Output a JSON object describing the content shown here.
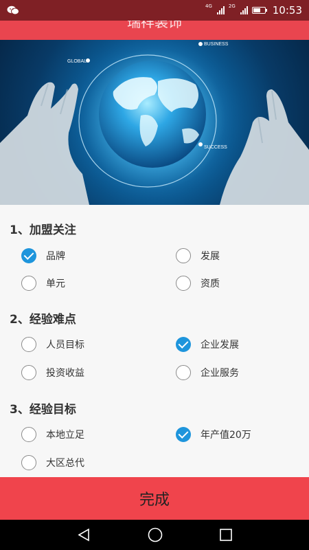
{
  "status_bar": {
    "left_icon": "wechat-icon",
    "net_label_1": "4G",
    "net_label_2": "2G",
    "time": "10:53",
    "battery_level": 0.6
  },
  "app": {
    "title": "瑞祥装饰"
  },
  "banner": {
    "global_label": "GLOBAL",
    "business_label": "BUSINESS",
    "success_label": "SUCCESS"
  },
  "form": {
    "sections": [
      {
        "title": "1、加盟关注",
        "options": [
          {
            "label": "品牌",
            "checked": true
          },
          {
            "label": "发展",
            "checked": false
          },
          {
            "label": "单元",
            "checked": false
          },
          {
            "label": "资质",
            "checked": false
          }
        ]
      },
      {
        "title": "2、经验难点",
        "options": [
          {
            "label": "人员目标",
            "checked": false
          },
          {
            "label": "企业发展",
            "checked": true
          },
          {
            "label": "投资收益",
            "checked": false
          },
          {
            "label": "企业服务",
            "checked": false
          }
        ]
      },
      {
        "title": "3、经验目标",
        "options": [
          {
            "label": "本地立足",
            "checked": false
          },
          {
            "label": "年产值20万",
            "checked": true
          },
          {
            "label": "大区总代",
            "checked": false
          }
        ]
      }
    ]
  },
  "done_button": {
    "label": "完成"
  },
  "nav_bar": {
    "back_icon": "back-triangle-icon",
    "home_icon": "home-circle-icon",
    "recent_icon": "recent-square-icon"
  },
  "colors": {
    "status_bar": "#7f2025",
    "app_bar": "#e9454f",
    "accent_check": "#1e95dc",
    "done_button": "#f0444c"
  }
}
